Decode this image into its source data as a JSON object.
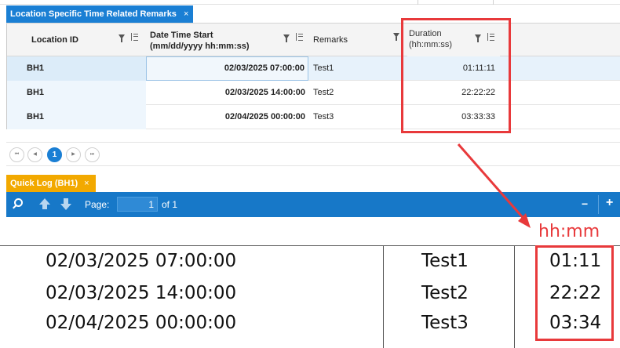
{
  "tabs": {
    "remarks_tab": {
      "label": "Location Specific Time Related Remarks",
      "close": "×"
    },
    "quicklog_tab": {
      "label": "Quick Log (BH1)",
      "close": "×"
    }
  },
  "grid": {
    "columns": [
      {
        "line1": "Location ID",
        "line2": ""
      },
      {
        "line1": "Date Time Start",
        "line2": "(mm/dd/yyyy hh:mm:ss)"
      },
      {
        "line1": "Remarks",
        "line2": ""
      },
      {
        "line1": "Duration",
        "line2": "(hh:mm:ss)"
      }
    ],
    "rows": [
      {
        "location": "BH1",
        "date": "02/03/2025 07:00:00",
        "remarks": "Test1",
        "duration": "01:11:11"
      },
      {
        "location": "BH1",
        "date": "02/03/2025 14:00:00",
        "remarks": "Test2",
        "duration": "22:22:22"
      },
      {
        "location": "BH1",
        "date": "02/04/2025 00:00:00",
        "remarks": "Test3",
        "duration": "03:33:33"
      }
    ]
  },
  "pager": {
    "first": "⏮",
    "prev": "◀",
    "current": "1",
    "next": "▶",
    "last": "⏭"
  },
  "toolbar": {
    "page_label": "Page:",
    "page_value": "1",
    "of_label": "of 1",
    "minus": "−",
    "plus": "+"
  },
  "report": {
    "rows": [
      {
        "date": "02/03/2025 07:00:00",
        "remarks": "Test1",
        "duration": "01:11"
      },
      {
        "date": "02/03/2025 14:00:00",
        "remarks": "Test2",
        "duration": "22:22"
      },
      {
        "date": "02/04/2025 00:00:00",
        "remarks": "Test3",
        "duration": "03:34"
      }
    ]
  },
  "annotation": {
    "format_label": "hh:mm",
    "color": "#e8393b"
  }
}
